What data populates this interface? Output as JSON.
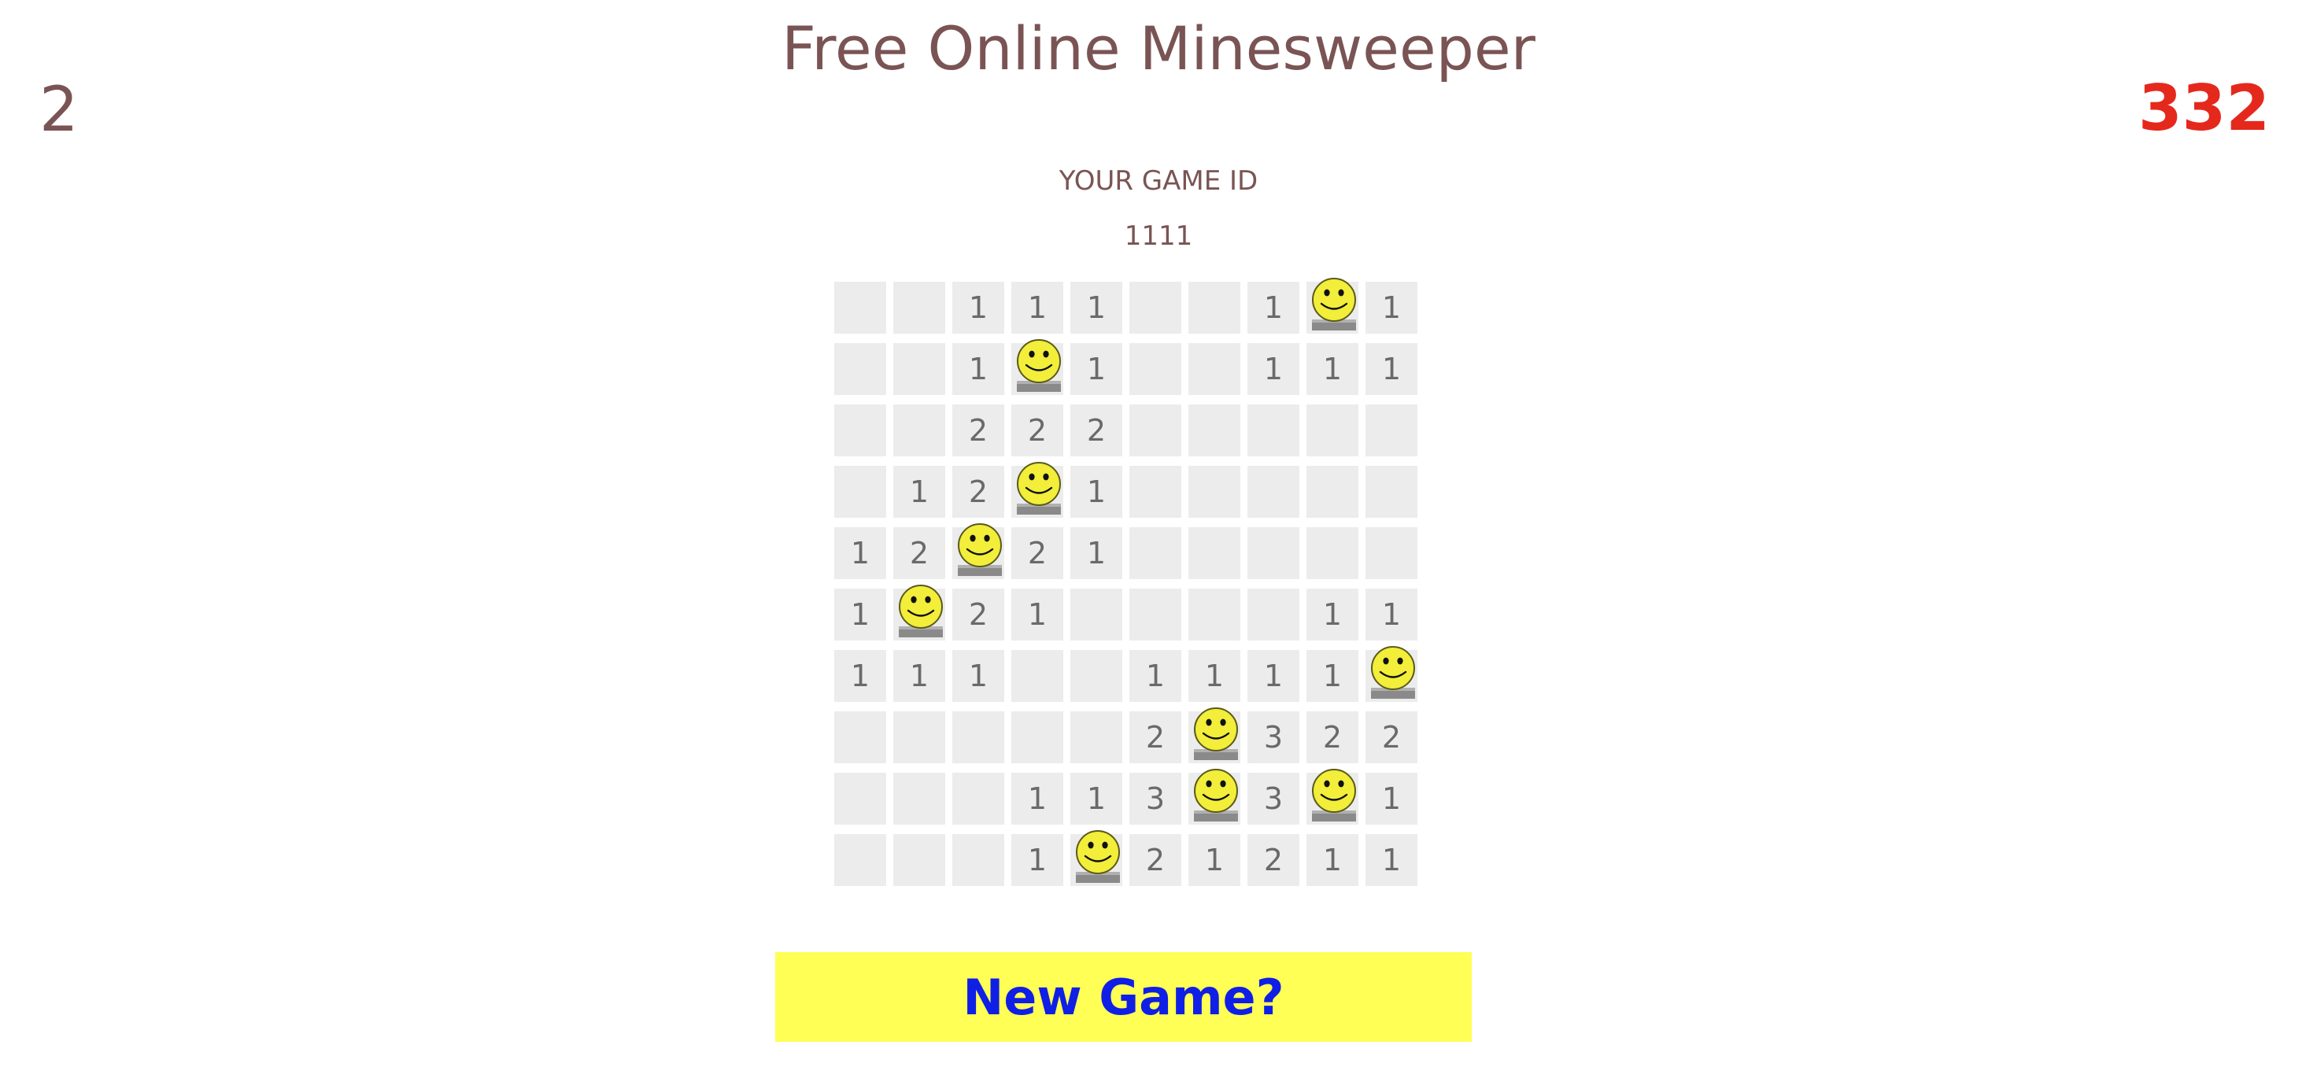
{
  "header": {
    "title": "Free Online Minesweeper",
    "left_counter": "2",
    "right_counter": "332"
  },
  "game": {
    "id_label": "YOUR GAME ID",
    "id_value": "1111"
  },
  "board": {
    "rows": 10,
    "cols": 10,
    "cells": [
      [
        "",
        "",
        "1",
        "1",
        "1",
        "",
        "",
        "1",
        "M",
        "1"
      ],
      [
        "",
        "",
        "1",
        "M",
        "1",
        "",
        "",
        "1",
        "1",
        "1"
      ],
      [
        "",
        "",
        "2",
        "2",
        "2",
        "",
        "",
        "",
        "",
        ""
      ],
      [
        "",
        "1",
        "2",
        "M",
        "1",
        "",
        "",
        "",
        "",
        ""
      ],
      [
        "1",
        "2",
        "M",
        "2",
        "1",
        "",
        "",
        "",
        "",
        ""
      ],
      [
        "1",
        "M",
        "2",
        "1",
        "",
        "",
        "",
        "",
        "1",
        "1"
      ],
      [
        "1",
        "1",
        "1",
        "",
        "",
        "1",
        "1",
        "1",
        "1",
        "M"
      ],
      [
        "",
        "",
        "",
        "",
        "",
        "2",
        "M",
        "3",
        "2",
        "2"
      ],
      [
        "",
        "",
        "",
        "1",
        "1",
        "3",
        "M",
        "3",
        "M",
        "1"
      ],
      [
        "",
        "",
        "",
        "1",
        "M",
        "2",
        "1",
        "2",
        "1",
        "1"
      ]
    ],
    "mine_icon": "smiley-mine-icon"
  },
  "actions": {
    "new_game_label": "New Game?"
  },
  "colors": {
    "title": "#7a5454",
    "counter_right": "#e5281c",
    "cell_bg": "#ececec",
    "number": "#6a6a6a",
    "button_bg": "#ffff55",
    "button_text": "#0f1fe6"
  }
}
